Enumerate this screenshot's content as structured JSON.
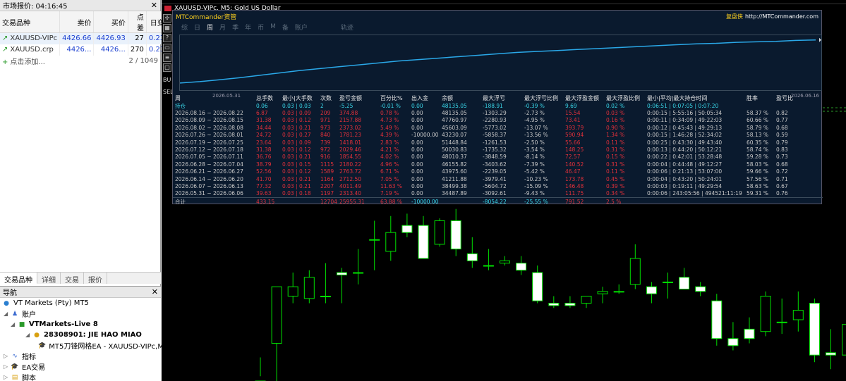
{
  "market_watch": {
    "title": "市场报价: 04:16:45",
    "columns": [
      "交易品种",
      "卖价",
      "买价",
      "点差",
      "日变化"
    ],
    "rows": [
      {
        "symbol": "XAUUSD-VIPc",
        "bid": "4426.66",
        "ask": "4426.93",
        "spread": "27",
        "change": "0.23%"
      },
      {
        "symbol": "XAUUSD.crp",
        "bid": "4426...",
        "ask": "4426...",
        "spread": "270",
        "change": "0.23%"
      }
    ],
    "add_label": "点击添加...",
    "count": "2 / 1049",
    "tabs": [
      "交易品种",
      "详细",
      "交易",
      "报价"
    ]
  },
  "navigator": {
    "title": "导航",
    "broker": "VT Markets (Pty) MT5",
    "accounts_label": "账户",
    "server": "VTMarkets-Live 8",
    "account": "28308901: JIE HAO MIAO",
    "ea": "MT5刀锋网格EA - XAUUSD-VIPc,M",
    "indicators": "指标",
    "ea_trading": "EA交易",
    "scripts": "脚本"
  },
  "chart": {
    "title": "XAUUSD-VIPc, M5:  Gold US Dollar",
    "left_labels": [
      "SEL",
      "BU"
    ],
    "toolbar_icons": [
      "crosshair-icon",
      "grid-icon",
      "zoom-icon",
      "folder-icon",
      "list-icon",
      "print-icon"
    ],
    "candles": [
      {
        "o": 0.0,
        "h": 0.02,
        "l": 0.1,
        "c": 0.0
      },
      {
        "o": 0.16,
        "h": 0.4,
        "l": 0.0,
        "c": 0.4
      },
      {
        "o": 0.36,
        "h": 0.46,
        "l": 0.33,
        "c": 0.4
      },
      {
        "o": 0.35,
        "h": 0.47,
        "l": 0.33,
        "c": 0.44
      },
      {
        "o": 0.36,
        "h": 0.5,
        "l": 0.33,
        "c": 0.36
      },
      {
        "o": 0.46,
        "h": 0.48,
        "l": 0.33,
        "c": 0.45
      },
      {
        "o": 0.46,
        "h": 0.56,
        "l": 0.41,
        "c": 0.46
      },
      {
        "o": 0.6,
        "h": 0.68,
        "l": 0.47,
        "c": 0.6
      },
      {
        "o": 0.55,
        "h": 0.7,
        "l": 0.51,
        "c": 0.63
      },
      {
        "o": 0.66,
        "h": 0.71,
        "l": 0.61,
        "c": 0.63
      },
      {
        "o": 0.66,
        "h": 0.7,
        "l": 0.55,
        "c": 0.52
      },
      {
        "o": 0.58,
        "h": 0.69,
        "l": 0.57,
        "c": 0.68
      },
      {
        "o": 0.68,
        "h": 0.73,
        "l": 0.53,
        "c": 0.56
      },
      {
        "o": 0.54,
        "h": 0.61,
        "l": 0.48,
        "c": 0.51
      },
      {
        "o": 0.49,
        "h": 0.56,
        "l": 0.47,
        "c": 0.49
      },
      {
        "o": 0.5,
        "h": 0.53,
        "l": 0.49,
        "c": 0.51
      },
      {
        "o": 0.5,
        "h": 0.53,
        "l": 0.45,
        "c": 0.47
      },
      {
        "o": 0.46,
        "h": 0.49,
        "l": 0.33,
        "c": 0.34
      },
      {
        "o": 0.33,
        "h": 0.36,
        "l": 0.31,
        "c": 0.32
      },
      {
        "o": 0.33,
        "h": 0.36,
        "l": 0.31,
        "c": 0.32
      },
      {
        "o": 0.33,
        "h": 0.36,
        "l": 0.31,
        "c": 0.36
      },
      {
        "o": 0.37,
        "h": 0.4,
        "l": 0.33,
        "c": 0.38
      },
      {
        "o": 0.38,
        "h": 0.41,
        "l": 0.37,
        "c": 0.38
      },
      {
        "o": 0.41,
        "h": 0.58,
        "l": 0.39,
        "c": 0.52
      },
      {
        "o": 0.4,
        "h": 0.42,
        "l": 0.33,
        "c": 0.37
      },
      {
        "o": 0.42,
        "h": 0.46,
        "l": 0.35,
        "c": 0.42
      },
      {
        "o": 0.44,
        "h": 0.48,
        "l": 0.4,
        "c": 0.39
      },
      {
        "o": 0.4,
        "h": 0.42,
        "l": 0.36,
        "c": 0.38
      },
      {
        "o": 0.34,
        "h": 0.37,
        "l": 0.15,
        "c": 0.18
      },
      {
        "o": 0.18,
        "h": 0.25,
        "l": 0.13,
        "c": 0.15
      },
      {
        "o": 0.22,
        "h": 0.27,
        "l": 0.16,
        "c": 0.18
      },
      {
        "o": 0.21,
        "h": 0.38,
        "l": 0.19,
        "c": 0.36
      },
      {
        "o": 0.25,
        "h": 0.35,
        "l": 0.2,
        "c": 0.25
      },
      {
        "o": 0.26,
        "h": 0.38,
        "l": 0.21,
        "c": 0.3
      },
      {
        "o": 0.33,
        "h": 0.35,
        "l": 0.08,
        "c": 0.11
      },
      {
        "o": 0.12,
        "h": 0.22,
        "l": 0.05,
        "c": 0.11
      },
      {
        "o": 0.11,
        "h": 0.25,
        "l": 0.05,
        "c": 0.24
      },
      {
        "o": 0.27,
        "h": 0.29,
        "l": 0.24,
        "c": 0.28
      }
    ]
  },
  "mtc": {
    "name": "MTCommander资管",
    "brand": "复盘侠",
    "url": "http://MTCommander.com",
    "tabs": [
      "综",
      "日",
      "周",
      "月",
      "季",
      "年",
      "币",
      "M",
      "备",
      "账户",
      "轨迹"
    ],
    "active_tab": "周",
    "graph_start": "2026.05.31",
    "graph_end": "2026.06.16",
    "equity_curve": [
      0.06,
      0.09,
      0.13,
      0.17,
      0.22,
      0.27,
      0.32,
      0.36,
      0.4,
      0.44,
      0.48,
      0.52,
      0.55,
      0.58,
      0.61,
      0.64,
      0.67,
      0.7,
      0.72,
      0.74,
      0.76,
      0.78,
      0.8,
      0.82,
      0.84,
      0.86,
      0.88,
      0.89,
      0.91,
      0.92,
      0.93,
      0.95,
      0.96
    ],
    "headers": [
      "周",
      "总手数",
      "最小|大手数",
      "次数",
      "盈亏金额",
      "百分比%",
      "出入金",
      "余额",
      "最大浮亏",
      "最大浮亏比例",
      "最大浮盈金额",
      "最大浮盈比例",
      "最小|平均|最大持仓时间",
      "胜率",
      "盈亏比"
    ],
    "position_row": [
      "持仓",
      "0.06",
      "0.03 | 0.03",
      "2",
      "-5.25",
      "-0.01 %",
      "0.00",
      "48135.05",
      "-188.91",
      "-0.39 %",
      "9.69",
      "0.02 %",
      "0:06:51 | 0:07:05 | 0:07:20",
      "",
      ""
    ],
    "rows": [
      [
        "2026.08.16 ~ 2026.08.22",
        "6.87",
        "0.03 | 0.09",
        "209",
        "374.88",
        "0.78 %",
        "0.00",
        "48135.05",
        "-1303.29",
        "-2.73 %",
        "15.54",
        "0.03 %",
        "0:00:15 | 5:55:16 | 50:05:34",
        "58.37 %",
        "0.82"
      ],
      [
        "2026.08.09 ~ 2026.08.15",
        "31.38",
        "0.03 | 0.12",
        "971",
        "2157.88",
        "4.73 %",
        "0.00",
        "47760.97",
        "-2280.93",
        "-4.95 %",
        "73.41",
        "0.16 %",
        "0:00:11 | 0:34:09 | 49:22:03",
        "60.66 %",
        "0.77"
      ],
      [
        "2026.08.02 ~ 2026.08.08",
        "34.44",
        "0.03 | 0.21",
        "973",
        "2373.02",
        "5.49 %",
        "0.00",
        "45603.09",
        "-5773.02",
        "-13.07 %",
        "393.79",
        "0.90 %",
        "0:00:12 | 0:45:43 | 49:29:13",
        "58.79 %",
        "0.68"
      ],
      [
        "2026.07.26 ~ 2026.08.01",
        "24.72",
        "0.03 | 0.27",
        "840",
        "1781.23",
        "4.39 %",
        "-10000.00",
        "43230.07",
        "-5858.37",
        "-13.56 %",
        "590.94",
        "1.34 %",
        "0:00:15 | 1:46:28 | 52:34:02",
        "58.13 %",
        "0.59"
      ],
      [
        "2026.07.19 ~ 2026.07.25",
        "23.64",
        "0.03 | 0.09",
        "739",
        "1418.01",
        "2.83 %",
        "0.00",
        "51448.84",
        "-1261.53",
        "-2.50 %",
        "55.66",
        "0.11 %",
        "0:00:25 | 0:43:30 | 49:43:40",
        "60.35 %",
        "0.79"
      ],
      [
        "2026.07.12 ~ 2026.07.18",
        "31.38",
        "0.03 | 0.12",
        "972",
        "2029.46",
        "4.21 %",
        "0.00",
        "50030.83",
        "-1735.32",
        "-3.54 %",
        "148.25",
        "0.31 %",
        "0:00:13 | 0:44:20 | 50:12:21",
        "58.74 %",
        "0.83"
      ],
      [
        "2026.07.05 ~ 2026.07.11",
        "36.76",
        "0.03 | 0.21",
        "916",
        "1854.55",
        "4.02 %",
        "0.00",
        "48010.37",
        "-3848.59",
        "-8.14 %",
        "72.57",
        "0.15 %",
        "0:00:22 | 0:42:01 | 53:28:48",
        "59.28 %",
        "0.73"
      ],
      [
        "2026.06.28 ~ 2026.07.04",
        "38.79",
        "0.03 | 0.15",
        "1115",
        "2180.22",
        "4.96 %",
        "0.00",
        "46155.82",
        "-3403.62",
        "-7.39 %",
        "140.52",
        "0.31 %",
        "0:00:04 | 0:44:48 | 49:12:27",
        "58.03 %",
        "0.68"
      ],
      [
        "2026.06.21 ~ 2026.06.27",
        "52.56",
        "0.03 | 0.12",
        "1589",
        "2763.72",
        "6.71 %",
        "0.00",
        "43975.60",
        "-2239.05",
        "-5.42 %",
        "46.47",
        "0.11 %",
        "0:00:06 | 0:21:13 | 53:07:00",
        "59.66 %",
        "0.72"
      ],
      [
        "2026.06.14 ~ 2026.06.20",
        "41.70",
        "0.03 | 0.21",
        "1164",
        "2712.50",
        "7.05 %",
        "0.00",
        "41211.88",
        "-3979.41",
        "-10.23 %",
        "173.78",
        "0.45 %",
        "0:00:04 | 0:43:20 | 50:24:01",
        "57.56 %",
        "0.71"
      ],
      [
        "2026.06.07 ~ 2026.06.13",
        "77.32",
        "0.03 | 0.21",
        "2207",
        "4011.49",
        "11.63 %",
        "0.00",
        "38499.38",
        "-5604.72",
        "-15.09 %",
        "146.48",
        "0.39 %",
        "0:00:03 | 0:19:11 | 49:29:54",
        "58.63 %",
        "0.67"
      ],
      [
        "2026.05.31 ~ 2026.06.06",
        "39.63",
        "0.03 | 0.18",
        "1197",
        "2313.40",
        "7.19 %",
        "0.00",
        "34487.89",
        "-3092.61",
        "-9.43 %",
        "111.75",
        "0.34 %",
        "0:00:06 | 243:05:56 | 494521:11:19",
        "59.31 %",
        "0.76"
      ]
    ],
    "total_row": [
      "合计",
      "433.15",
      "",
      "12704",
      "25955.31",
      "63.88 %",
      "-10000.00",
      "",
      "-8054.22",
      "-25.55 %",
      "791.52",
      "2.5 %",
      "",
      "",
      ""
    ]
  }
}
